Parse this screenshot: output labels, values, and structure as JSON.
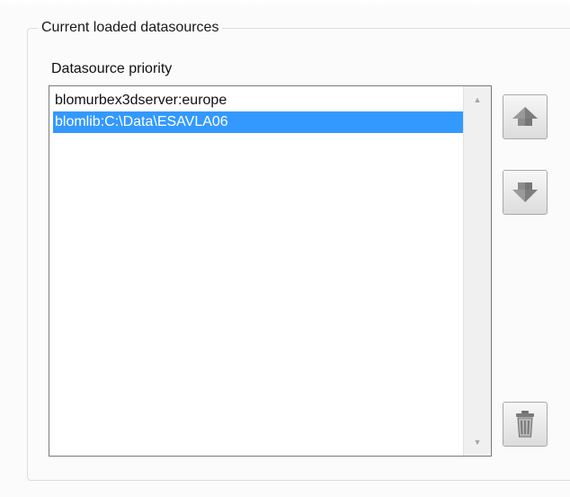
{
  "groupbox": {
    "title": "Current loaded datasources"
  },
  "priority": {
    "label": "Datasource priority",
    "items": [
      {
        "text": "blomurbex3dserver:europe",
        "selected": false
      },
      {
        "text": "blomlib:C:\\Data\\ESAVLA06",
        "selected": true
      }
    ]
  },
  "buttons": {
    "move_up_icon": "arrow-up-icon",
    "move_down_icon": "arrow-down-icon",
    "delete_icon": "trash-icon"
  },
  "colors": {
    "selection": "#3399ff",
    "selection_text": "#ffffff",
    "border": "#7a7a7a"
  }
}
